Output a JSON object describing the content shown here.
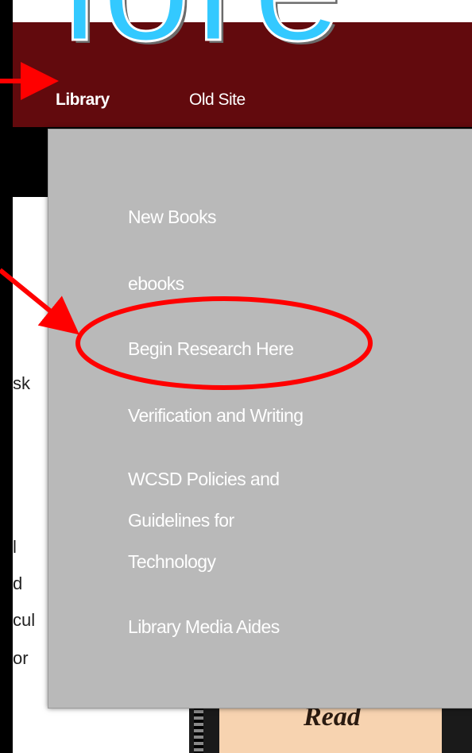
{
  "nav": {
    "items": [
      {
        "label": "Library"
      },
      {
        "label": "Old Site"
      }
    ]
  },
  "logo": {
    "text": "lore"
  },
  "dropdown": {
    "items": [
      {
        "label": "New Books"
      },
      {
        "label": "ebooks"
      },
      {
        "label": "Begin Research Here"
      },
      {
        "label": "Verification and Writing"
      },
      {
        "label": "WCSD Policies and"
      },
      {
        "label": "Guidelines for"
      },
      {
        "label": "Technology"
      },
      {
        "label": "Library Media Aides"
      }
    ]
  },
  "background": {
    "fragments": [
      "sk",
      "l",
      "d",
      "cul",
      "or"
    ]
  },
  "book": {
    "cover_text": "Read"
  },
  "colors": {
    "navbar": "#620a0d",
    "dropdown": "#b9b9b9",
    "annotation": "#ff0000",
    "logo": "#33c9ff"
  }
}
